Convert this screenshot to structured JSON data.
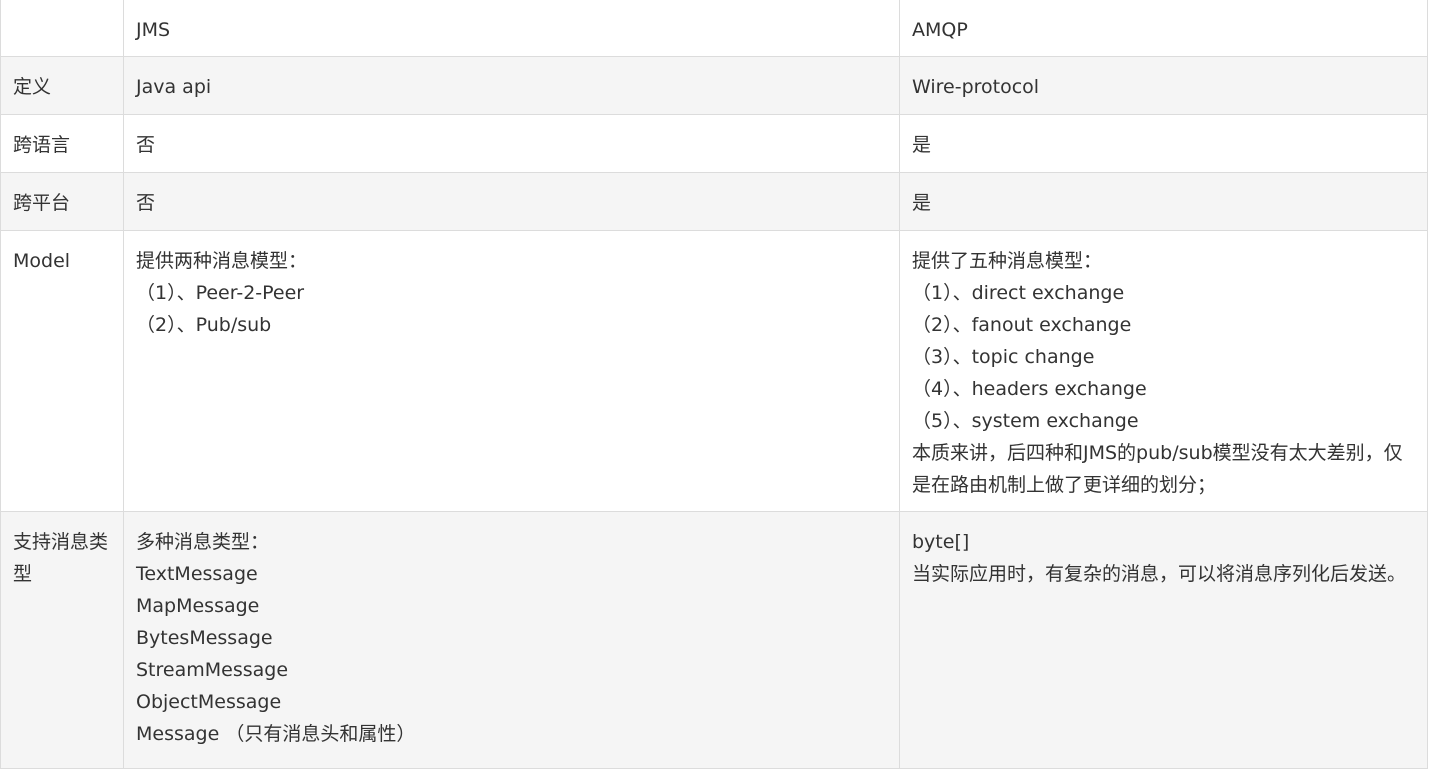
{
  "table": {
    "header": {
      "label": "",
      "jms": "JMS",
      "amqp": "AMQP"
    },
    "rows": [
      {
        "label": "定义",
        "jms": [
          "Java api"
        ],
        "amqp": [
          "Wire-protocol"
        ]
      },
      {
        "label": "跨语言",
        "jms": [
          "否"
        ],
        "amqp": [
          "是"
        ]
      },
      {
        "label": "跨平台",
        "jms": [
          "否"
        ],
        "amqp": [
          "是"
        ]
      },
      {
        "label": "Model",
        "jms": [
          "提供两种消息模型：",
          "（1）、Peer-2-Peer",
          "（2）、Pub/sub"
        ],
        "amqp": [
          "提供了五种消息模型：",
          "（1）、direct exchange",
          "（2）、fanout exchange",
          "（3）、topic change",
          "（4）、headers exchange",
          "（5）、system exchange",
          "本质来讲，后四种和JMS的pub/sub模型没有太大差别，仅是在路由机制上做了更详细的划分；"
        ]
      },
      {
        "label": "支持消息类型",
        "jms": [
          "多种消息类型：",
          "TextMessage",
          "MapMessage",
          "BytesMessage",
          "StreamMessage",
          "ObjectMessage",
          "Message （只有消息头和属性）"
        ],
        "amqp": [
          "byte[]",
          "当实际应用时，有复杂的消息，可以将消息序列化后发送。"
        ]
      }
    ]
  }
}
